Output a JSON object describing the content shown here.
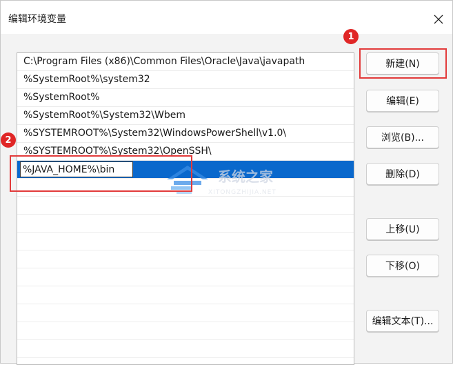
{
  "window": {
    "title": "编辑环境变量"
  },
  "path_list": {
    "entries": [
      "C:\\Program Files (x86)\\Common Files\\Oracle\\Java\\javapath",
      "%SystemRoot%\\system32",
      "%SystemRoot%",
      "%SystemRoot%\\System32\\Wbem",
      "%SYSTEMROOT%\\System32\\WindowsPowerShell\\v1.0\\",
      "%SYSTEMROOT%\\System32\\OpenSSH\\"
    ],
    "editing_value": "%JAVA_HOME%\\bin"
  },
  "buttons": {
    "new": "新建(N)",
    "edit": "编辑(E)",
    "browse": "浏览(B)...",
    "delete": "删除(D)",
    "move_up": "上移(U)",
    "move_down": "下移(O)",
    "edit_text": "编辑文本(T)..."
  },
  "annotations": {
    "step1": "1",
    "step2": "2"
  },
  "watermark": {
    "text": "系统之家",
    "subtext": "XITONGZHIJIA.NET"
  },
  "colors": {
    "selection": "#0a68cc",
    "annotation_red": "#e23a3a"
  },
  "icons": {
    "close": "close-icon",
    "watermark_logo": "house-logo-icon"
  }
}
